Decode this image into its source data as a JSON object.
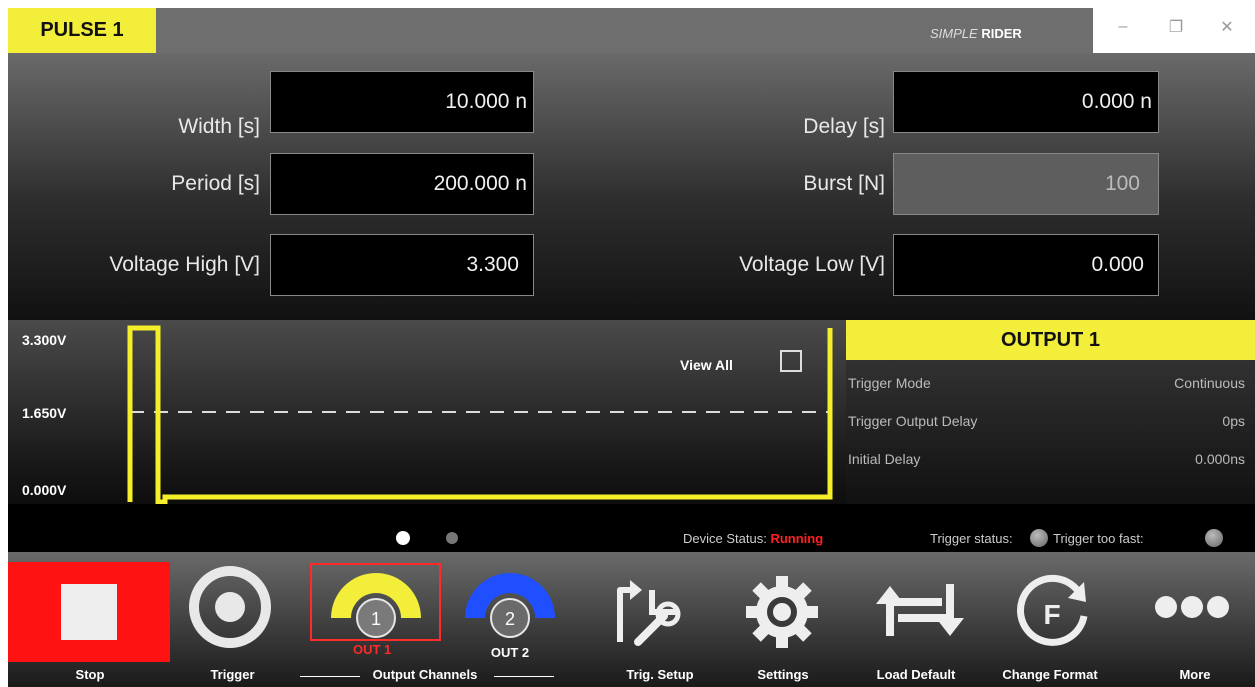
{
  "window": {
    "tab_title": "PULSE 1",
    "brand_italic": "SIMPLE",
    "brand_bold": "RIDER",
    "minimize": "–",
    "restore": "❐",
    "close": "✕"
  },
  "params": {
    "width_label": "Width [s]",
    "width_value": "10.000 n",
    "delay_label": "Delay [s]",
    "delay_value": "0.000 n",
    "period_label": "Period [s]",
    "period_value": "200.000 n",
    "burst_label": "Burst [N]",
    "burst_value": "100",
    "vhigh_label": "Voltage High [V]",
    "vhigh_value": "3.300",
    "vlow_label": "Voltage Low [V]",
    "vlow_value": "0.000"
  },
  "waveform": {
    "v_high": "3.300V",
    "v_mid": "1.650V",
    "v_low": "0.000V",
    "view_all": "View All"
  },
  "output": {
    "title": "OUTPUT 1",
    "rows": [
      {
        "label": "Trigger Mode",
        "value": "Continuous"
      },
      {
        "label": "Trigger Output Delay",
        "value": "0ps"
      },
      {
        "label": "Initial Delay",
        "value": "0.000ns"
      }
    ]
  },
  "status": {
    "device_status_label": "Device Status:",
    "device_status_value": "Running",
    "trigger_status_label": "Trigger status:",
    "trigger_too_fast_label": "Trigger too fast:"
  },
  "toolbar": {
    "stop": "Stop",
    "trigger": "Trigger",
    "output_channels": "Output Channels",
    "out1": "OUT 1",
    "out1_num": "1",
    "out2": "OUT 2",
    "out2_num": "2",
    "trig_setup": "Trig. Setup",
    "settings": "Settings",
    "load_default": "Load Default",
    "change_format": "Change Format",
    "more": "More"
  },
  "colors": {
    "accent_yellow": "#f2ee3a",
    "stop_red": "#ff1212",
    "channel2_blue": "#1f4fff",
    "running_red": "#ff2020"
  }
}
